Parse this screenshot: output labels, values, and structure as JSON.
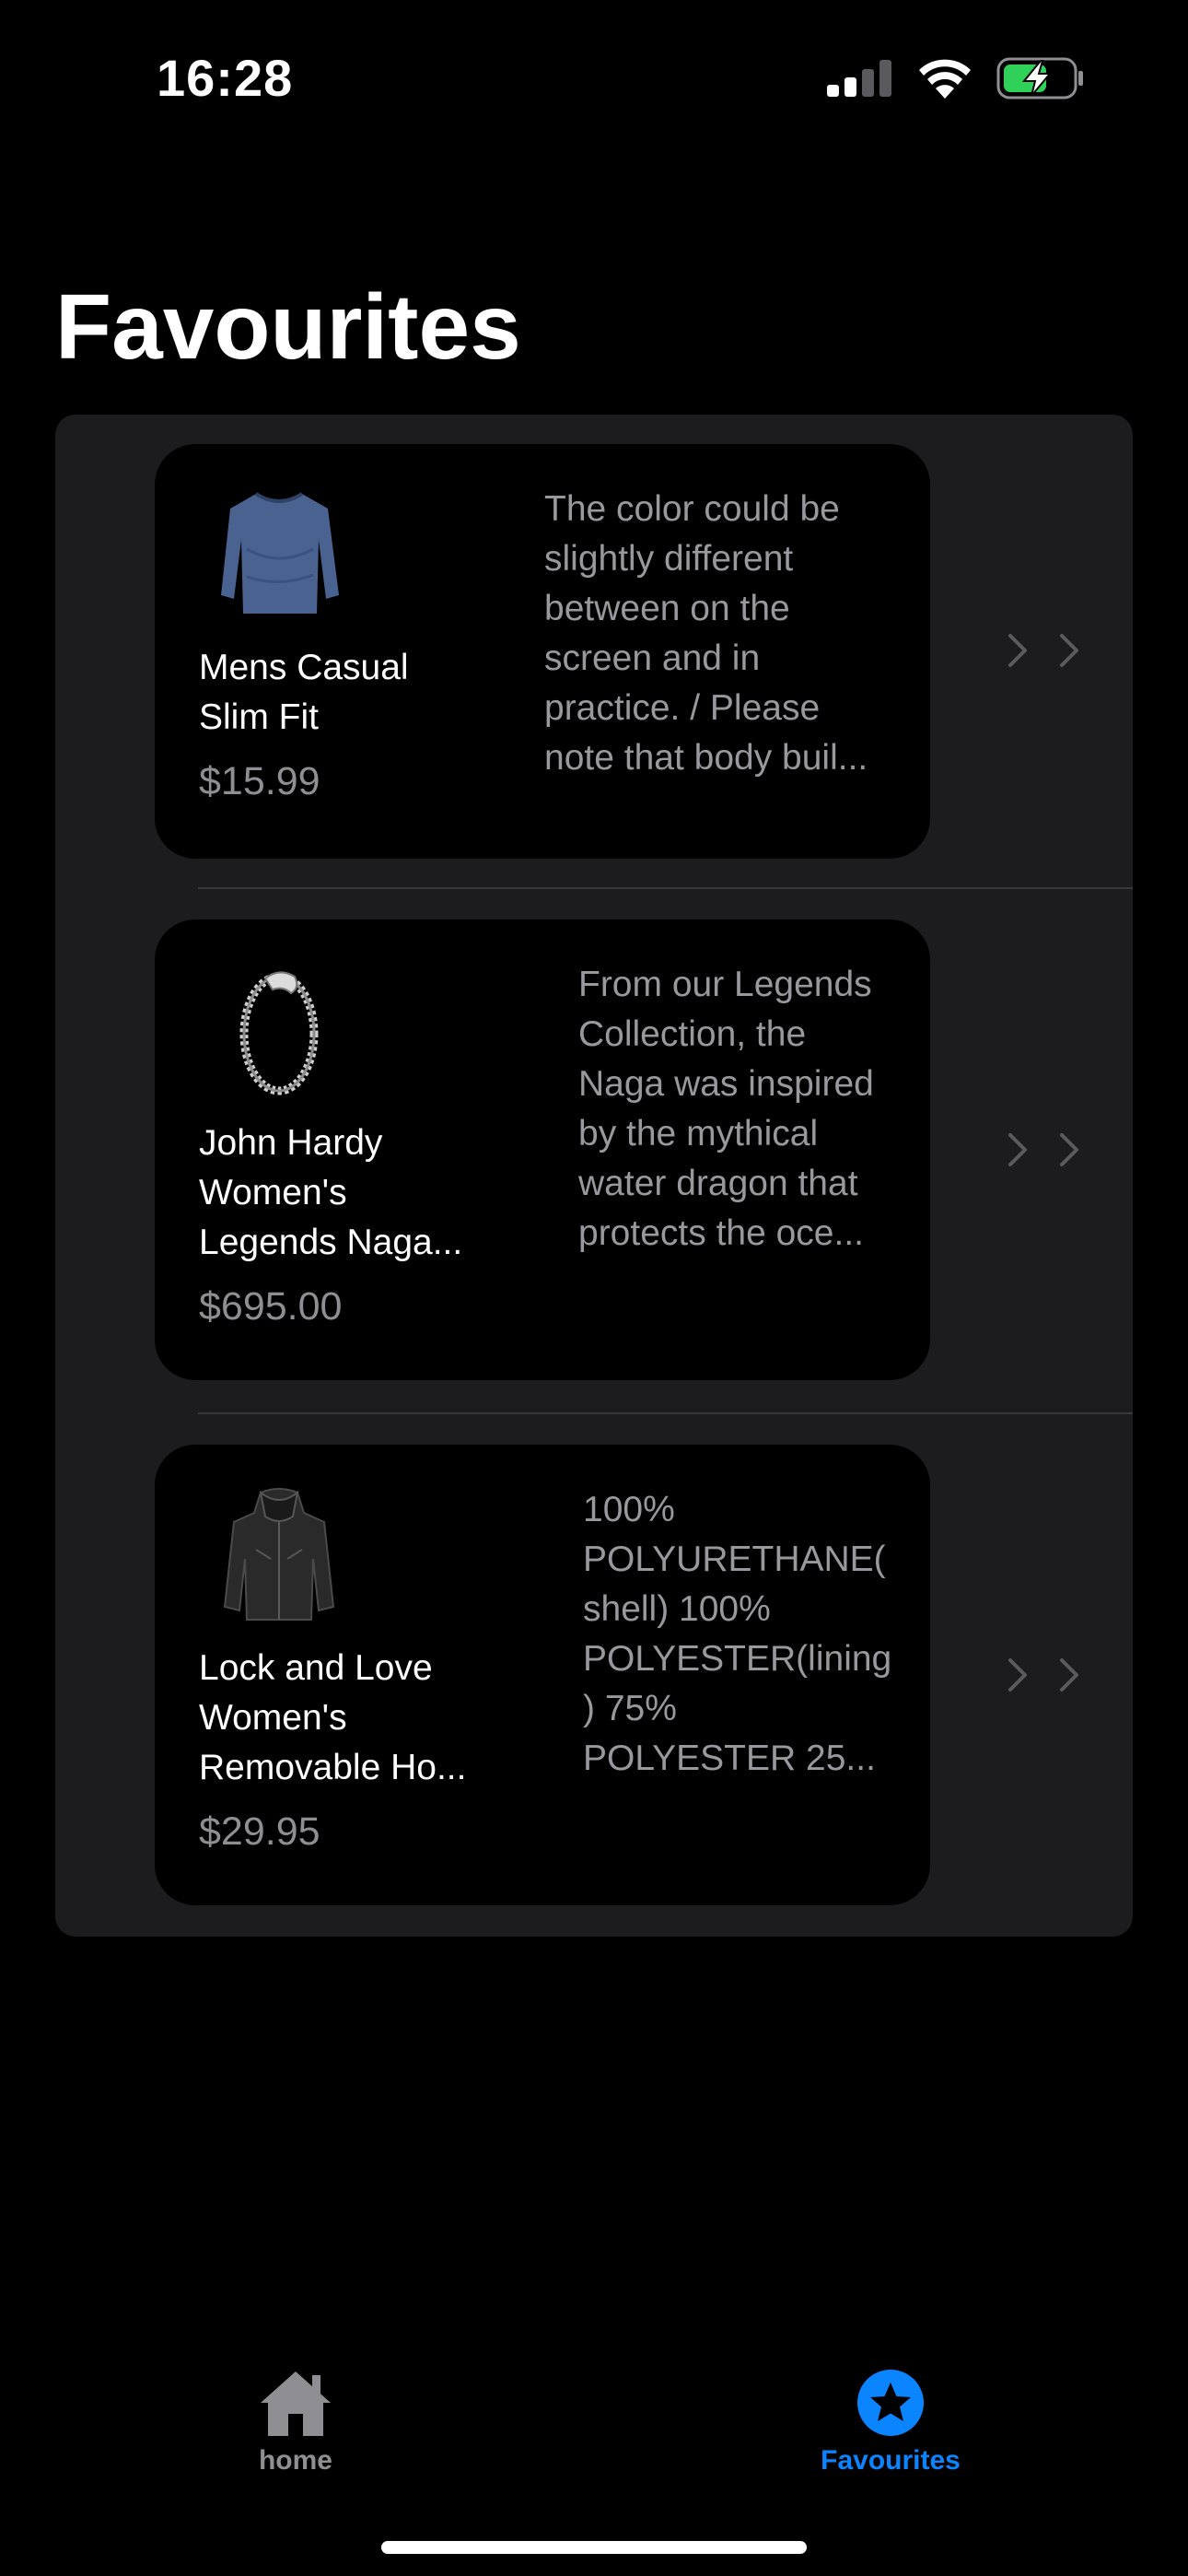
{
  "status_bar": {
    "time": "16:28",
    "icons": [
      "cellular-signal-icon",
      "wifi-icon",
      "battery-charging-icon"
    ],
    "battery_color": "#30d158"
  },
  "page": {
    "title": "Favourites"
  },
  "favourites": [
    {
      "name": "Mens Casual\nSlim Fit",
      "price": "$15.99",
      "description": "The color could be\nslightly different\nbetween on the\nscreen and in\npractice. / Please\nnote that body buil...",
      "thumbnail": "blue-long-sleeve-shirt"
    },
    {
      "name": "John Hardy\nWomen's\nLegends Naga...",
      "price": "$695.00",
      "description": "From our Legends\nCollection, the\nNaga was inspired\nby the mythical\nwater dragon that\nprotects the oce...",
      "thumbnail": "silver-dragon-bracelet"
    },
    {
      "name": "Lock and Love\nWomen's\nRemovable Ho...",
      "price": "$29.95",
      "description": "100%\nPOLYURETHANE(\nshell) 100%\nPOLYESTER(lining\n) 75%\nPOLYESTER 25...",
      "thumbnail": "black-leather-jacket"
    }
  ],
  "tab_bar": {
    "tabs": [
      {
        "label": "home",
        "icon": "house-icon",
        "selected": false
      },
      {
        "label": "Favourites",
        "icon": "star-circle-icon",
        "selected": true
      }
    ],
    "accent_color": "#0a84ff",
    "inactive_color": "#8e8e93"
  }
}
